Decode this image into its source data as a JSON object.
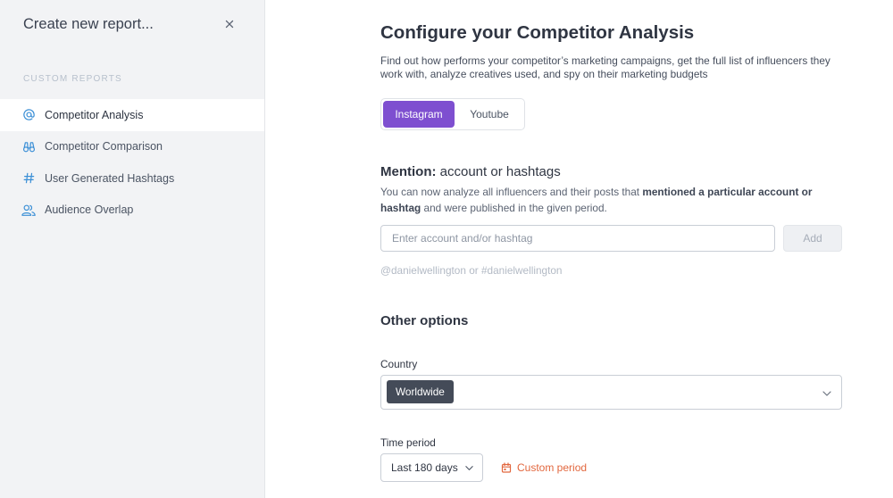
{
  "sidebar": {
    "title": "Create new report...",
    "section_label": "CUSTOM REPORTS",
    "items": [
      {
        "label": "Competitor Analysis",
        "icon": "at-icon",
        "active": true
      },
      {
        "label": "Competitor Comparison",
        "icon": "binoculars-icon",
        "active": false
      },
      {
        "label": "User Generated Hashtags",
        "icon": "hashtag-icon",
        "active": false
      },
      {
        "label": "Audience Overlap",
        "icon": "users-icon",
        "active": false
      }
    ]
  },
  "main": {
    "title": "Configure your Competitor Analysis",
    "description": "Find out how performs your competitor’s marketing campaigns, get the full list of influencers they work with, analyze creatives used, and spy on their marketing budgets",
    "tabs": [
      {
        "label": "Instagram",
        "selected": true
      },
      {
        "label": "Youtube",
        "selected": false
      }
    ],
    "mention": {
      "title_bold": "Mention:",
      "title_rest": " account or hashtags",
      "desc_start": "You can now analyze all influencers and their posts that ",
      "desc_bold": "mentioned a particular account or hashtag",
      "desc_end": " and were published in the given period.",
      "input_placeholder": "Enter account and/or hashtag",
      "add_label": "Add",
      "example": "@danielwellington or #danielwellington"
    },
    "other_options": {
      "title": "Other options",
      "country_label": "Country",
      "country_value": "Worldwide",
      "time_label": "Time period",
      "time_value": "Last 180 days",
      "custom_period_label": "Custom period"
    }
  },
  "colors": {
    "accent_purple": "#7e4fd0",
    "custom_period_orange": "#e2673e",
    "nav_icon_blue": "#3b8fd6",
    "chip_dark": "#444b58"
  }
}
